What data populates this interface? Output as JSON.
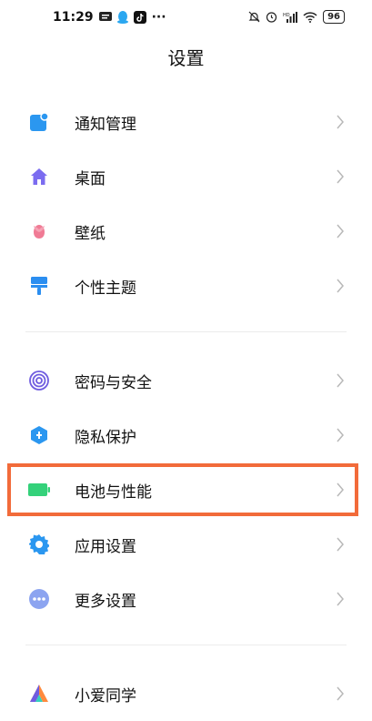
{
  "status_bar": {
    "time": "11:29",
    "battery": "96",
    "dots": "···"
  },
  "header": {
    "title": "设置"
  },
  "groups": [
    [
      {
        "label": "通知管理",
        "icon": "notification-icon"
      },
      {
        "label": "桌面",
        "icon": "home-icon"
      },
      {
        "label": "壁纸",
        "icon": "tulip-icon"
      },
      {
        "label": "个性主题",
        "icon": "paint-brush-icon"
      }
    ],
    [
      {
        "label": "密码与安全",
        "icon": "fingerprint-icon"
      },
      {
        "label": "隐私保护",
        "icon": "shield-icon"
      },
      {
        "label": "电池与性能",
        "icon": "battery-icon"
      },
      {
        "label": "应用设置",
        "icon": "gear-icon"
      },
      {
        "label": "更多设置",
        "icon": "more-icon"
      }
    ],
    [
      {
        "label": "小爱同学",
        "icon": "xiaoai-icon"
      }
    ]
  ],
  "colors": {
    "notification": "#2b97f0",
    "home": "#7b6cf0",
    "tulip": "#f07b95",
    "brush": "#2b8ef0",
    "fingerprint": "#6f5ce0",
    "shield": "#2b97f0",
    "battery": "#34d17a",
    "gear": "#2b97f0",
    "more": "#8ca4f0",
    "highlight": "#f26b3a"
  }
}
